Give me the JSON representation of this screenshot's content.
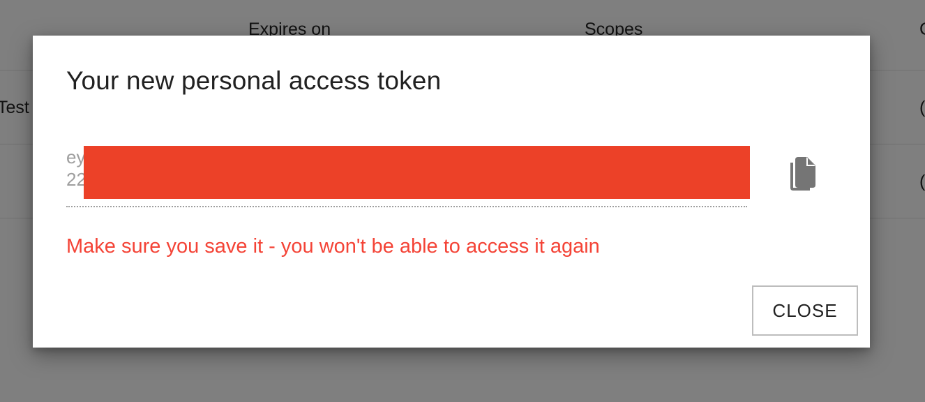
{
  "background_table": {
    "headers": [
      "Expires on",
      "Scopes",
      "C"
    ],
    "rows": [
      {
        "name": "Test",
        "last": "("
      },
      {
        "name": "",
        "last": "("
      }
    ]
  },
  "dialog": {
    "title": "Your new personal access token",
    "token": {
      "line1": "ey",
      "line2": "22",
      "redacted_color": "#ec4128"
    },
    "copy_icon": "content-copy-icon",
    "warning": "Make sure you save it - you won't be able to access it again",
    "warning_color": "#f44336",
    "close_label": "CLOSE"
  }
}
